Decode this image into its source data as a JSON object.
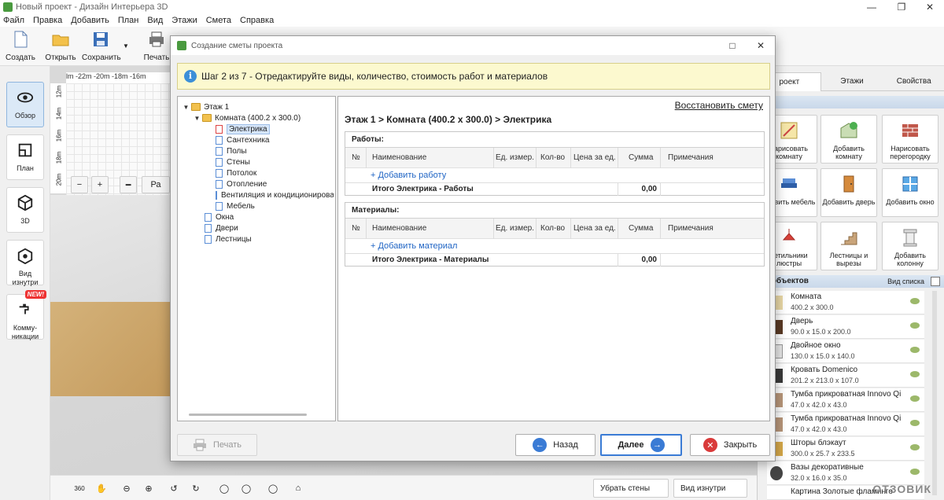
{
  "app": {
    "title": "Новый проект - Дизайн Интерьера 3D",
    "menu": [
      "Файл",
      "Правка",
      "Добавить",
      "План",
      "Вид",
      "Этажи",
      "Смета",
      "Справка"
    ],
    "toolbar": [
      {
        "label": "Создать",
        "icon": "new-document-icon"
      },
      {
        "label": "Открыть",
        "icon": "open-folder-icon"
      },
      {
        "label": "Сохранить",
        "icon": "save-icon"
      },
      {
        "label": "Печать",
        "icon": "print-icon"
      }
    ],
    "leftcol": [
      {
        "label": "Обзор",
        "icon": "eye-icon"
      },
      {
        "label": "План",
        "icon": "plan-icon"
      },
      {
        "label": "3D",
        "icon": "cube-3d-icon"
      },
      {
        "label": "Вид изнутри",
        "icon": "inside-view-icon"
      },
      {
        "label": "Комму- никации",
        "icon": "faucet-icon",
        "badge": "NEW!"
      }
    ],
    "ruler_top": "lm  -22m  -20m  -18m  -16m",
    "ruler_left": [
      "12m",
      "14m",
      "16m",
      "18m",
      "20m"
    ],
    "plan_tool_label": "Ра",
    "bottombar": {
      "hide_walls": "Убрать стены",
      "inside_view": "Вид изнутри",
      "rotate_label": "360"
    },
    "right_panel": {
      "tabs": [
        "роект",
        "Этажи",
        "Свойства"
      ],
      "section_title": "йн",
      "tiles": [
        {
          "label": "нарисовать комнату",
          "icon": "draw-room-icon"
        },
        {
          "label": "Добавить комнату",
          "icon": "add-room-icon"
        },
        {
          "label": "Нарисовать перегородку",
          "icon": "brick-wall-icon"
        },
        {
          "label": "обавить мебель",
          "icon": "armchair-icon"
        },
        {
          "label": "Добавить дверь",
          "icon": "door-icon"
        },
        {
          "label": "Добавить окно",
          "icon": "window-icon"
        },
        {
          "label": "ветильники люстры",
          "icon": "lamp-icon"
        },
        {
          "label": "Лестницы и вырезы",
          "icon": "stairs-icon"
        },
        {
          "label": "Добавить колонну",
          "icon": "column-icon"
        }
      ],
      "objects_title": "ок объектов",
      "list_view": "Вид списка",
      "objects": [
        {
          "name": "Комната",
          "size": "400.2 x 300.0"
        },
        {
          "name": "Дверь",
          "size": "90.0 x 15.0 x 200.0"
        },
        {
          "name": "Двойное окно",
          "size": "130.0 x 15.0 x 140.0"
        },
        {
          "name": "Кровать Domenico",
          "size": "201.2 x 213.0 x 107.0"
        },
        {
          "name": "Тумба прикроватная Innovo Qi",
          "size": "47.0 x 42.0 x 43.0"
        },
        {
          "name": "Тумба прикроватная Innovo Qi",
          "size": "47.0 x 42.0 x 43.0"
        },
        {
          "name": "Шторы блэкаут",
          "size": "300.0 x 25.7 x 233.5"
        },
        {
          "name": "Вазы декоративные",
          "size": "32.0 x 16.0 x 35.0"
        },
        {
          "name": "Картина Золотые фламинго",
          "size": ""
        }
      ]
    },
    "watermark": "ОТЗОВИК"
  },
  "dialog": {
    "title": "Создание сметы проекта",
    "step_text": "Шаг 2 из 7 - Отредактируйте виды, количество, стоимость работ и материалов",
    "restore_link": "Восстановить смету",
    "breadcrumb": "Этаж 1 > Комната (400.2 x 300.0) > Электрика",
    "tree": {
      "floor": "Этаж 1",
      "room": "Комната (400.2 x 300.0)",
      "categories": [
        "Электрика",
        "Сантехника",
        "Полы",
        "Стены",
        "Потолок",
        "Отопление",
        "Вентиляция и кондиционирование",
        "Мебель"
      ],
      "others": [
        "Окна",
        "Двери",
        "Лестницы"
      ]
    },
    "columns": [
      "№",
      "Наименование",
      "Ед. измер.",
      "Кол-во",
      "Цена за ед.",
      "Сумма",
      "Примечания"
    ],
    "works": {
      "title": "Работы:",
      "add": "+ Добавить работу",
      "total_label": "Итого Электрика - Работы",
      "total_value": "0,00"
    },
    "materials": {
      "title": "Материалы:",
      "add": "+ Добавить материал",
      "total_label": "Итого Электрика - Материалы",
      "total_value": "0,00"
    },
    "buttons": {
      "print": "Печать",
      "back": "Назад",
      "next": "Далее",
      "close": "Закрыть"
    }
  }
}
